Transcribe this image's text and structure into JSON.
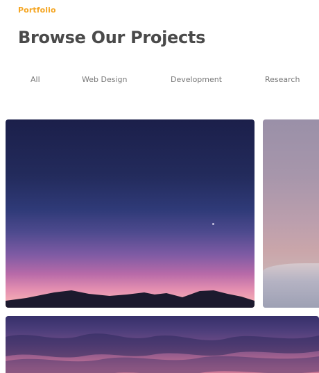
{
  "section": {
    "eyebrow": "Portfolio",
    "title": "Browse Our Projects"
  },
  "filters": [
    {
      "label": "All"
    },
    {
      "label": "Web Design"
    },
    {
      "label": "Development"
    },
    {
      "label": "Research"
    }
  ],
  "colors": {
    "accent": "#f5a623",
    "heading": "#4a4a4a",
    "filter_text": "#777777"
  },
  "projects": [
    {
      "image": "sunset-mountains-photo"
    },
    {
      "image": "pink-sky-ice-photo"
    },
    {
      "image": "purple-clouds-photo"
    }
  ]
}
